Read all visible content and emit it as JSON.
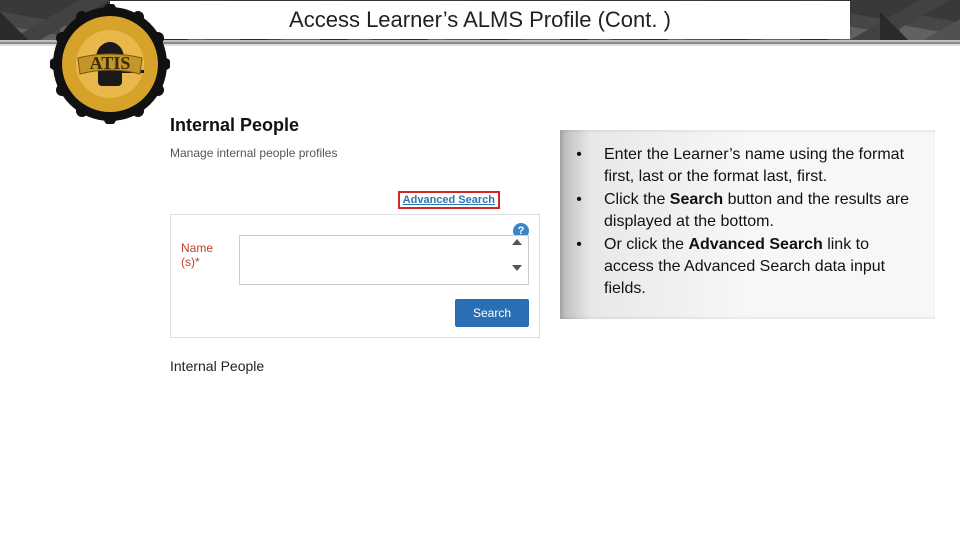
{
  "header": {
    "title": "Access Learner’s ALMS Profile (Cont. )"
  },
  "seal": {
    "logo_text": "ATIS"
  },
  "panel": {
    "heading": "Internal People",
    "subheading": "Manage internal people profiles",
    "advanced_link": "Advanced Search",
    "name_label_1": "Name",
    "name_label_2": "(s)*",
    "search_button": "Search",
    "section_heading": "Internal People",
    "help_symbol": "?"
  },
  "instructions": {
    "items": [
      {
        "bullet": "•",
        "text_pre": "Enter the Learner’s name using the format first, last or the format last, first.",
        "bold": ""
      },
      {
        "bullet": "•",
        "text_pre": "Click the ",
        "bold": "Search",
        "text_post": " button and the results are displayed at the bottom."
      },
      {
        "bullet": "•",
        "text_pre": "Or click the ",
        "bold": "Advanced Search",
        "text_post": " link to access the Advanced Search data input fields."
      }
    ]
  }
}
